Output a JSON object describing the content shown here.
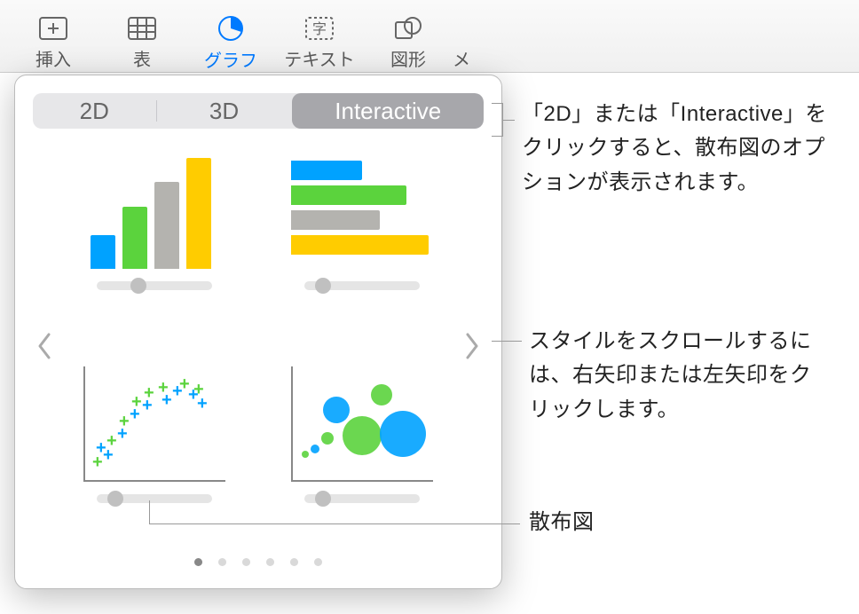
{
  "toolbar": {
    "items": [
      {
        "label": "挿入",
        "icon": "insert"
      },
      {
        "label": "表",
        "icon": "table"
      },
      {
        "label": "グラフ",
        "icon": "chart",
        "active": true
      },
      {
        "label": "テキスト",
        "icon": "text"
      },
      {
        "label": "図形",
        "icon": "shape"
      },
      {
        "label": "メ",
        "icon": "media"
      }
    ]
  },
  "popover": {
    "tabs": {
      "two_d": "2D",
      "three_d": "3D",
      "interactive": "Interactive"
    },
    "selected_tab": "Interactive",
    "page_count": 6,
    "page_index": 0,
    "charts": [
      {
        "type": "vertical-bar"
      },
      {
        "type": "horizontal-bar"
      },
      {
        "type": "scatter"
      },
      {
        "type": "bubble"
      }
    ]
  },
  "callouts": {
    "tabs_hint": "「2D」または「Interactive」をクリックすると、散布図のオプションが表示されます。",
    "arrows_hint": "スタイルをスクロールするには、右矢印または左矢印をクリックします。",
    "scatter_label": "散布図"
  },
  "colors": {
    "blue": "#00a2ff",
    "green": "#5bd33d",
    "gray": "#b4b3af",
    "yellow": "#ffcc00"
  }
}
